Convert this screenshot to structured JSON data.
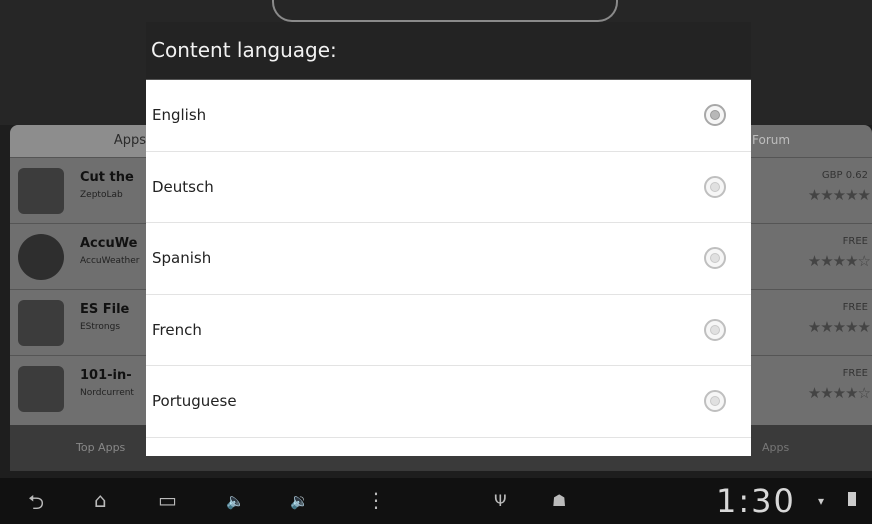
{
  "background": {
    "left_tab": "Apps",
    "right_tab": "Forum",
    "rows": [
      {
        "name": "Cut the",
        "publisher": "ZeptoLab",
        "price": "GBP 0.62",
        "stars": "★★★★★"
      },
      {
        "name": "AccuWe",
        "publisher": "AccuWeather",
        "price": "FREE",
        "stars": "★★★★☆"
      },
      {
        "name": "ES File",
        "publisher": "EStrongs",
        "price": "FREE",
        "stars": "★★★★★"
      },
      {
        "name": "101-in-",
        "publisher": "Nordcurrent",
        "price": "FREE",
        "stars": "★★★★☆"
      }
    ],
    "footer_left": "Top Apps",
    "footer_right": "Apps"
  },
  "dialog": {
    "title": "Content language:",
    "options": [
      {
        "label": "English",
        "selected": true
      },
      {
        "label": "Deutsch",
        "selected": false
      },
      {
        "label": "Spanish",
        "selected": false
      },
      {
        "label": "French",
        "selected": false
      },
      {
        "label": "Portuguese",
        "selected": false
      }
    ]
  },
  "system_bar": {
    "time": "1:30",
    "icons": [
      "back-icon",
      "home-icon",
      "recent-apps-icon",
      "volume-down-icon",
      "volume-up-icon",
      "menu-icon",
      "usb-icon",
      "android-debug-icon",
      "wifi-icon",
      "battery-icon"
    ]
  }
}
